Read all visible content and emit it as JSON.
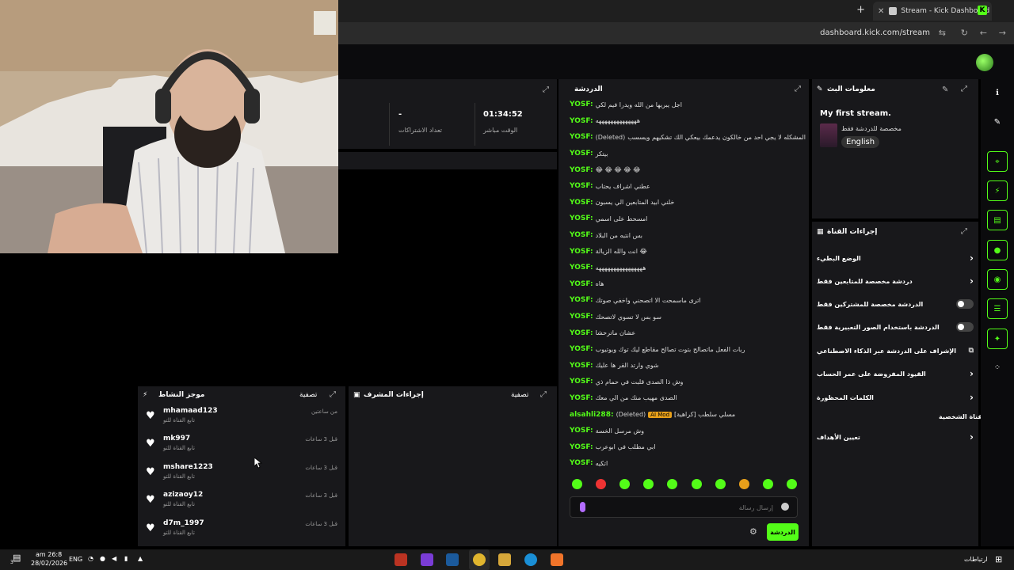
{
  "browser": {
    "tab_title": "Stream - Kick Dashboard",
    "tab_close": "✕",
    "new_tab": "+",
    "url": "dashboard.kick.com/stream",
    "kick_ext": "K"
  },
  "stats": {
    "live_time": "01:34:52",
    "live_time_label": "الوقت مباشر",
    "subs_value": "-",
    "subs_label": "تعداد الاشتراكات"
  },
  "chat": {
    "title": "الدردشة",
    "messages": [
      {
        "user": "YOSF:",
        "deleted": "",
        "badge": "",
        "text": "اجل يبريها من الله ويدرا فيم لكي"
      },
      {
        "user": "YOSF:",
        "deleted": "",
        "badge": "",
        "text": "ههههههههههههههه"
      },
      {
        "user": "YOSF:",
        "deleted": "(Deleted)",
        "badge": "",
        "text": "المشكله لا يجي احد من خالكون يدعمك بيعكي الك تشكيهم ويسسب"
      },
      {
        "user": "YOSF:",
        "deleted": "",
        "badge": "",
        "text": "بيتكر"
      },
      {
        "user": "YOSF:",
        "deleted": "",
        "badge": "",
        "text": "😂 😂 😂 😂 😂"
      },
      {
        "user": "YOSF:",
        "deleted": "",
        "badge": "",
        "text": "عطني اشراف يحتاب"
      },
      {
        "user": "YOSF:",
        "deleted": "",
        "badge": "",
        "text": "خلني ابيد المتابعين الي يسبون"
      },
      {
        "user": "YOSF:",
        "deleted": "",
        "badge": "",
        "text": "امسحط على اسمي"
      },
      {
        "user": "YOSF:",
        "deleted": "",
        "badge": "",
        "text": "بس انتبه من البلاد"
      },
      {
        "user": "YOSF:",
        "deleted": "",
        "badge": "",
        "text": "انت والله الزيالة 😂"
      },
      {
        "user": "YOSF:",
        "deleted": "",
        "badge": "",
        "text": "ههههههههههههههههه"
      },
      {
        "user": "YOSF:",
        "deleted": "",
        "badge": "",
        "text": "هاه"
      },
      {
        "user": "YOSF:",
        "deleted": "",
        "badge": "",
        "text": "اترى ماسمحت الا اتصحني واخفي صوتك"
      },
      {
        "user": "YOSF:",
        "deleted": "",
        "badge": "",
        "text": "سو بس لا تسوي لاتصحك"
      },
      {
        "user": "YOSF:",
        "deleted": "",
        "badge": "",
        "text": "عشان ماترحشا"
      },
      {
        "user": "YOSF:",
        "deleted": "",
        "badge": "",
        "text": "ربات الفعل ماتصالح بتوت تصالح مقاطع ليك توك ويوتيوب"
      },
      {
        "user": "YOSF:",
        "deleted": "",
        "badge": "",
        "text": "شوي وارتد القر ها عليك"
      },
      {
        "user": "YOSF:",
        "deleted": "",
        "badge": "",
        "text": "وش ذا الصدى قلبت في حمام ذي"
      },
      {
        "user": "YOSF:",
        "deleted": "",
        "badge": "",
        "text": "الصدى مهيب منك من الي معك"
      },
      {
        "user": "alsahli288:",
        "deleted": "(Deleted)",
        "badge": "AI Mod",
        "text": "مسلي سلطب [كراهية]"
      },
      {
        "user": "YOSF:",
        "deleted": "",
        "badge": "",
        "text": "وش مرسل الخسة"
      },
      {
        "user": "YOSF:",
        "deleted": "",
        "badge": "",
        "text": "ابي مطلب في ابوعرب"
      },
      {
        "user": "YOSF:",
        "deleted": "",
        "badge": "",
        "text": "اتكيه"
      }
    ],
    "input_placeholder": "إرسال رسالة",
    "send_label": "الدردشة"
  },
  "stream_info": {
    "title": "معلومات البث",
    "stream_title": "My first stream.",
    "category": "مخصصة للدردشة فقط",
    "language": "English"
  },
  "channel_actions": {
    "title": "إجراءات القناة",
    "rows": [
      {
        "label": "الوضع البطيء",
        "control": "chevron"
      },
      {
        "label": "دردشة مخصصة للمتابعين فقط",
        "control": "chevron"
      },
      {
        "label": "الدردشة مخصصة للمشتركين فقط",
        "control": "toggle"
      },
      {
        "label": "الدردشة باستخدام الصور التعبيرية فقط",
        "control": "toggle"
      },
      {
        "label": "الإشراف على الدردشة عبر الذكاء الاصطناعي",
        "control": "external"
      },
      {
        "label": "القيود المفروضة على عمر الحساب",
        "control": "chevron"
      },
      {
        "label": "الكلمات المحظورة",
        "control": "chevron"
      }
    ],
    "section_label": "القناة الشخصية",
    "goals_label": "تعيين الأهداف"
  },
  "activity_feed": {
    "title": "موجز النشاط",
    "filter_label": "تصفية",
    "items": [
      {
        "name": "mhamaad123",
        "sub": "تابع القناة للتو",
        "time": "من ساعتين"
      },
      {
        "name": "mk997",
        "sub": "تابع القناة للتو",
        "time": "قبل 3 ساعات"
      },
      {
        "name": "mshare1223",
        "sub": "تابع القناة للتو",
        "time": "قبل 3 ساعات"
      },
      {
        "name": "azizaoy12",
        "sub": "تابع القناة للتو",
        "time": "قبل 3 ساعات"
      },
      {
        "name": "d7m_1997",
        "sub": "تابع القناة للتو",
        "time": "قبل 3 ساعات"
      }
    ]
  },
  "mod_actions": {
    "title": "إجراءات المشرف",
    "filter_label": "تصفية"
  },
  "taskbar": {
    "time": "am 26:8",
    "date": "28/02/2026",
    "lang": "ENG",
    "notif_count": "3",
    "right_label": "ارتباطات"
  },
  "colors": {
    "accent": "#53fc18",
    "panel": "#18181b",
    "background": "#000000"
  }
}
